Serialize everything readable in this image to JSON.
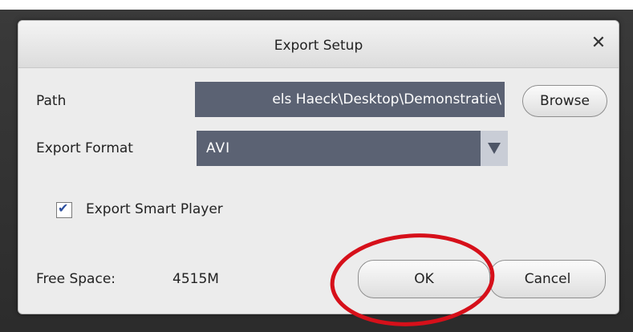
{
  "dialog": {
    "title": "Export Setup",
    "close_icon": "close-icon",
    "path": {
      "label": "Path",
      "value": "els Haeck\\Desktop\\Demonstratie\\"
    },
    "browse_label": "Browse",
    "export_format": {
      "label": "Export Format",
      "selected": "AVI",
      "arrow_icon": "triangle-down-icon"
    },
    "smart_player": {
      "label": "Export Smart Player",
      "checked": true
    },
    "free_space": {
      "label": "Free Space:",
      "value": "4515M"
    },
    "ok_label": "OK",
    "cancel_label": "Cancel"
  },
  "colors": {
    "field_bg": "#5b6273",
    "highlight_circle": "#d6101a"
  }
}
